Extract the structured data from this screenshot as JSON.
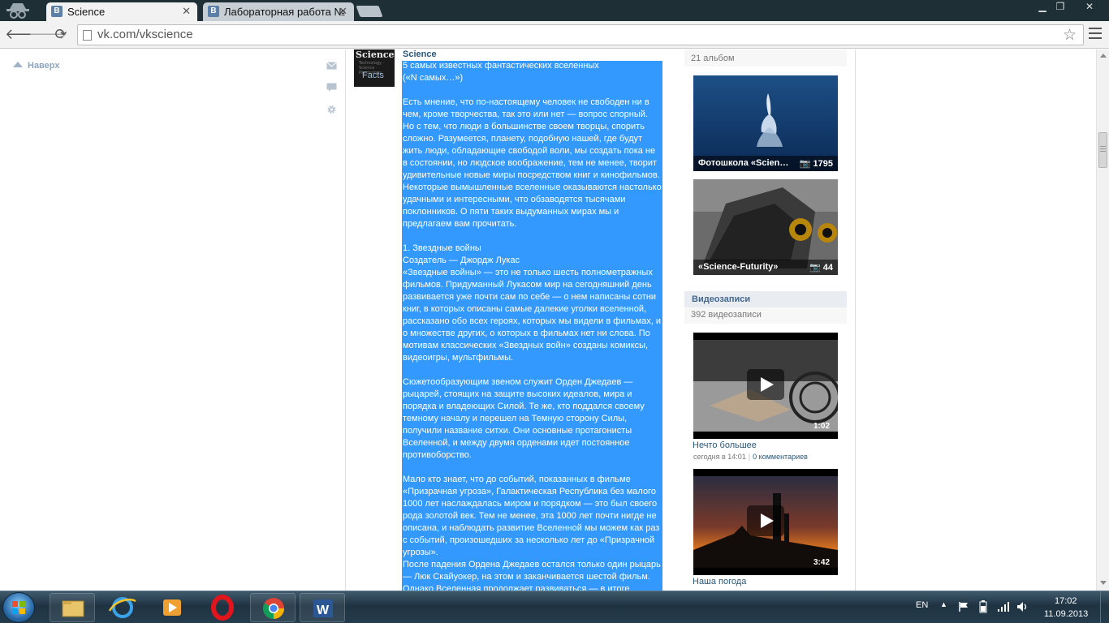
{
  "browser": {
    "tabs": [
      {
        "label": "Science",
        "favicon": "B"
      },
      {
        "label": "Лабораторная работа №",
        "favicon": "B"
      }
    ],
    "url": "vk.com/vkscience"
  },
  "left_nav": {
    "up_label": "Наверх"
  },
  "post": {
    "author": "Science",
    "avatar_text": [
      "Science",
      "Facts",
      "Technology · Science · Psychology"
    ],
    "lines": [
      "5 самых известных фантастических вселенных",
      "(«N самых…»)",
      "",
      "Есть мнение, что по-настоящему человек не свободен ни в",
      "чем, кроме творчества, так это или нет — вопрос спорный.",
      "Но с тем, что люди в большинстве своем творцы, спорить",
      "сложно. Разумеется, планету, подобную нашей, где будут",
      "жить люди, обладающие свободой воли, мы создать пока не",
      "в состоянии, но людское воображение, тем не менее, творит",
      "удивительные новые миры посредством книг и кинофильмов.",
      "Некоторые вымышленные вселенные оказываются настолько",
      "удачными и интересными, что обзаводятся тысячами",
      "поклонников. О пяти таких выдуманных мирах мы и",
      "предлагаем вам прочитать.",
      "",
      "1. Звездные войны",
      "Создатель — Джордж Лукас",
      "«Звездные войны» — это не только шесть полнометражных",
      "фильмов. Придуманный Лукасом мир на сегодняшний день",
      "развивается уже почти сам по себе — о нем написаны сотни",
      "книг, в которых описаны самые далекие уголки вселенной,",
      "рассказано обо всех героях, которых мы видели в фильмах, и",
      "о множестве других, о которых в фильмах нет ни слова. По",
      "мотивам классических «Звездных войн» созданы комиксы,",
      "видеоигры, мультфильмы.",
      "",
      "Сюжетообразующим звеном служит Орден Джедаев —",
      "рыцарей, стоящих на защите высоких идеалов, мира и",
      "порядка и владеющих Силой. Те же, кто поддался своему",
      "темному началу и перешел на Темную сторону Силы,",
      "получили название ситхи. Они основные протагонисты",
      "Вселенной, и между двумя орденами идет постоянное",
      "противоборство.",
      "",
      "Мало кто знает, что до событий, показанных в фильме",
      "«Призрачная угроза», Галактическая Республика без малого",
      "1000 лет наслаждалась миром и порядком — это был своего",
      "рода золотой век. Тем не менее, эта 1000 лет почти нигде не",
      "описана, и наблюдать развитие Вселенной мы можем как раз",
      "с событий, произошедших за несколько лет до «Призрачной",
      "угрозы».",
      "После падения Ордена Джедаев остался только один рыцарь",
      "— Люк Скайуокер, на этом и заканчивается шестой фильм.",
      "Однако Вселенная продолжает развиваться — в итоге"
    ]
  },
  "albums": {
    "count_label": "21 альбом",
    "items": [
      {
        "title": "Фотошкола «Scien…",
        "count": "1795"
      },
      {
        "title": "«Science-Futurity»",
        "count": "44"
      }
    ]
  },
  "videos": {
    "header": "Видеозаписи",
    "count_label": "392 видеозаписи",
    "items": [
      {
        "title": "Нечто большее",
        "duration": "1:02",
        "date": "сегодня в 14:01",
        "comments": "0 комментариев"
      },
      {
        "title": "Наша погода",
        "duration": "3:42",
        "date": "",
        "comments": ""
      }
    ]
  },
  "taskbar": {
    "language": "EN",
    "time": "17:02",
    "date": "11.09.2013"
  },
  "colors": {
    "selection": "#3399ff",
    "vk_link": "#2b587a",
    "vk_header": "#45688e",
    "titlebar": "#1f2f36"
  }
}
